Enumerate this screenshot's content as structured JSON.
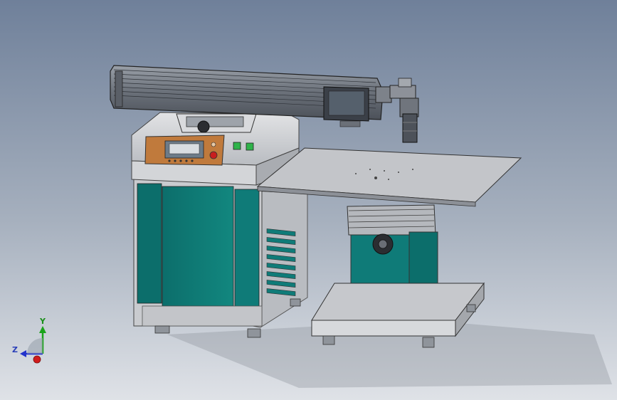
{
  "triad": {
    "y_label": "Y",
    "z_label": "Z",
    "y_color": "#1aa31a",
    "z_color": "#2233cc",
    "x_color": "#d01c1c"
  },
  "colors": {
    "cabinet_teal": "#0f7b78",
    "cabinet_frame": "#c9cbcf",
    "control_panel": "#c07a3c",
    "button_green": "#2fb34a",
    "emergency_red": "#c81e1e"
  }
}
